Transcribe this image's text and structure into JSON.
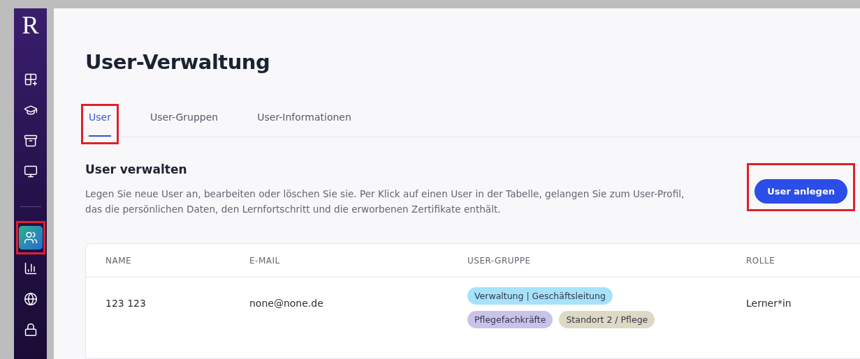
{
  "sidebar": {
    "logo": "R",
    "top_items": [
      {
        "kind": "apps",
        "selected": false,
        "annotated": false
      },
      {
        "kind": "courses",
        "selected": false,
        "annotated": false
      },
      {
        "kind": "archive",
        "selected": false,
        "annotated": false
      },
      {
        "kind": "monitor",
        "selected": false,
        "annotated": false
      }
    ],
    "bottom_items": [
      {
        "kind": "users",
        "selected": true,
        "annotated": true
      },
      {
        "kind": "reports",
        "selected": false,
        "annotated": false
      },
      {
        "kind": "globe",
        "selected": false,
        "annotated": false
      },
      {
        "kind": "lock",
        "selected": false,
        "annotated": false
      }
    ]
  },
  "page_title": "User-Verwaltung",
  "tabs": [
    {
      "label": "User",
      "selected": true,
      "annotated": true
    },
    {
      "label": "User-Gruppen",
      "selected": false,
      "annotated": false
    },
    {
      "label": "User-Informationen",
      "selected": false,
      "annotated": false
    }
  ],
  "section": {
    "title": "User verwalten",
    "description": "Legen Sie neue User an, bearbeiten oder löschen Sie sie. Per Klick auf einen User in der Tabelle, gelangen Sie zum User-Profil, das die persönlichen Daten, den Lernfortschritt und die erworbenen Zertifikate enthält.",
    "button": {
      "label": "User anlegen",
      "annotated": true
    }
  },
  "table": {
    "columns": [
      "NAME",
      "E-MAIL",
      "USER-GRUPPE",
      "ROLLE"
    ],
    "rows": [
      {
        "name": "123 123",
        "email": "none@none.de",
        "groups": [
          [
            {
              "label": "Verwaltung | Geschäftsleitung",
              "color": "#a6e3fb"
            }
          ],
          [
            {
              "label": "Pflegefachkräfte",
              "color": "#cbc2e9"
            },
            {
              "label": "Standort 2 / Pflege",
              "color": "#ddd9c5"
            }
          ]
        ],
        "role": "Lerner*in"
      }
    ]
  }
}
